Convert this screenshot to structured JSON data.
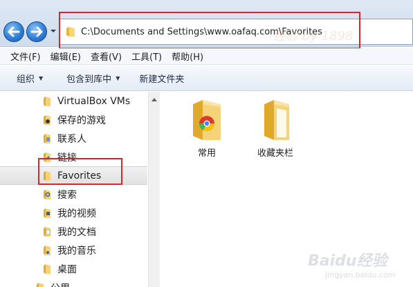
{
  "address_bar": {
    "path": "C:\\Documents and Settings\\www.oafaq.com\\Favorites"
  },
  "menu": [
    {
      "label": "文件(F)"
    },
    {
      "label": "编辑(E)"
    },
    {
      "label": "查看(V)"
    },
    {
      "label": "工具(T)"
    },
    {
      "label": "帮助(H)"
    }
  ],
  "toolbar": {
    "organize_label": "组织",
    "include_label": "包含到库中",
    "new_folder_label": "新建文件夹"
  },
  "nav": {
    "items": [
      {
        "label": "VirtualBox VMs",
        "icon": "folder-icon"
      },
      {
        "label": "保存的游戏",
        "icon": "saved-games-icon"
      },
      {
        "label": "联系人",
        "icon": "contacts-icon"
      },
      {
        "label": "链接",
        "icon": "links-icon"
      },
      {
        "label": "Favorites",
        "icon": "folder-icon",
        "selected": true
      },
      {
        "label": "搜索",
        "icon": "searches-icon"
      },
      {
        "label": "我的视频",
        "icon": "my-videos-icon"
      },
      {
        "label": "我的文档",
        "icon": "my-documents-icon"
      },
      {
        "label": "我的音乐",
        "icon": "my-music-icon"
      },
      {
        "label": "桌面",
        "icon": "desktop-folder-icon"
      },
      {
        "label": "公用",
        "icon": "folder-icon"
      }
    ]
  },
  "files": [
    {
      "label": "常用",
      "icon": "chrome-folder-icon"
    },
    {
      "label": "收藏夹栏",
      "icon": "folder-icon"
    }
  ],
  "watermark": {
    "baidu": "Baidu经验",
    "baidu_sub": "jingyan.baidu.com"
  },
  "colors": {
    "annotation_red": "#e0222a",
    "folder_yellow": "#f2c65a",
    "toolbar_bg": "#e3ebf6"
  }
}
